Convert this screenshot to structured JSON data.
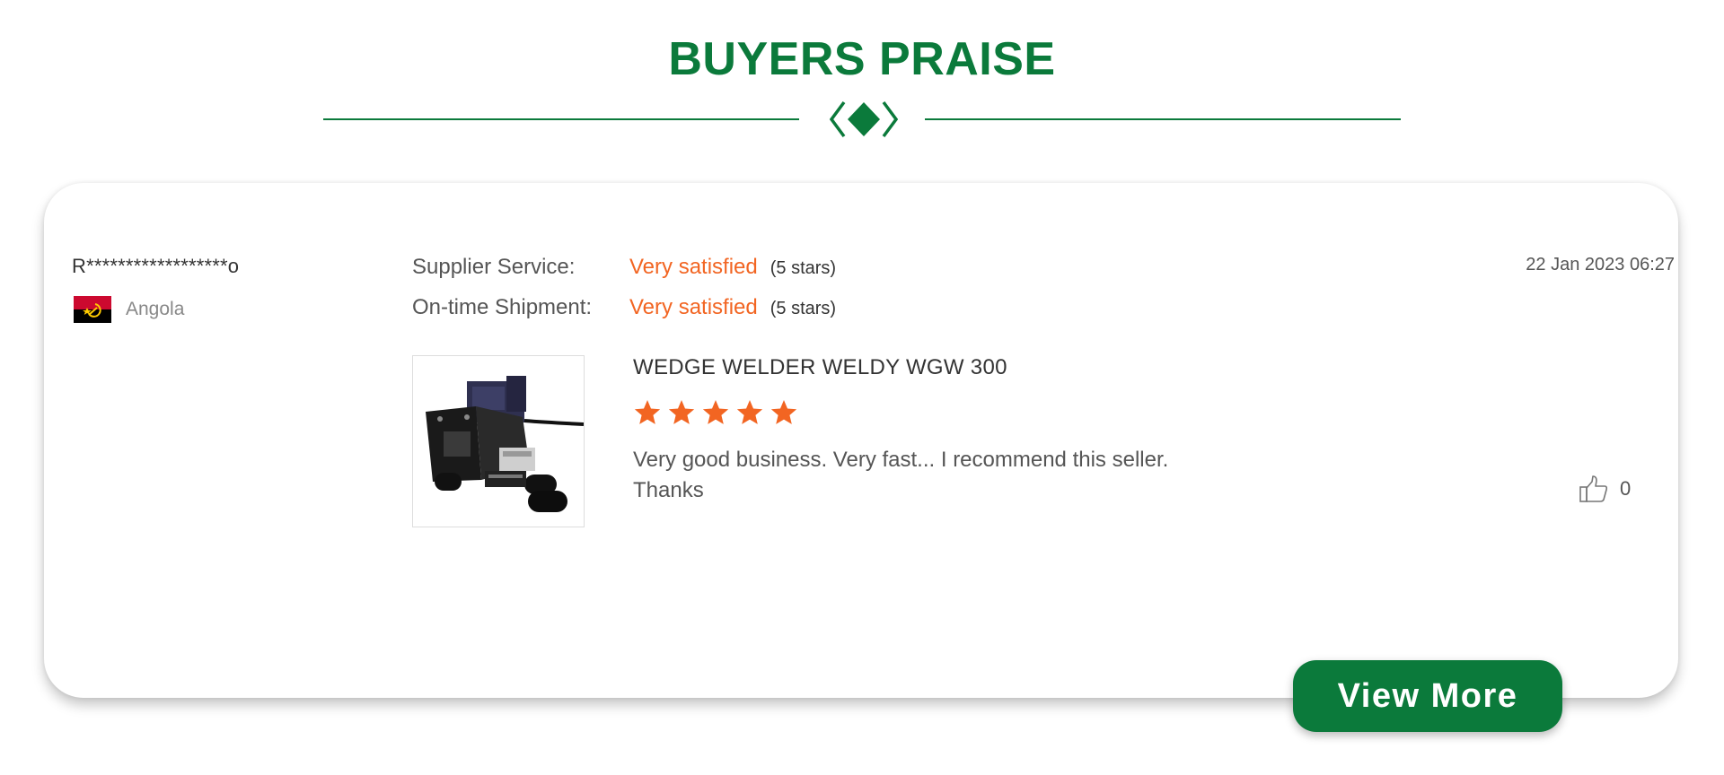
{
  "header": {
    "title": "BUYERS PRAISE"
  },
  "review": {
    "buyer_name": "R******************o",
    "country": "Angola",
    "flag_icon": "angola-flag-icon",
    "date": "22 Jan 2023 06:27",
    "ratings": [
      {
        "label": "Supplier Service:",
        "value": "Very satisfied",
        "stars_text": "(5 stars)"
      },
      {
        "label": "On-time Shipment:",
        "value": "Very satisfied",
        "stars_text": "(5 stars)"
      }
    ],
    "product": {
      "title": "WEDGE WELDER WELDY WGW 300",
      "rating": 5,
      "rating_max": 5,
      "image_icon": "wedge-welder-product-image"
    },
    "text_line1": "Very good business. Very fast... I recommend this seller.",
    "text_line2": "Thanks",
    "like_count": "0",
    "like_icon": "thumbs-up-icon"
  },
  "actions": {
    "view_more_label": "View More"
  },
  "colors": {
    "brand_green": "#0b7a3b",
    "accent_orange": "#f26522"
  }
}
